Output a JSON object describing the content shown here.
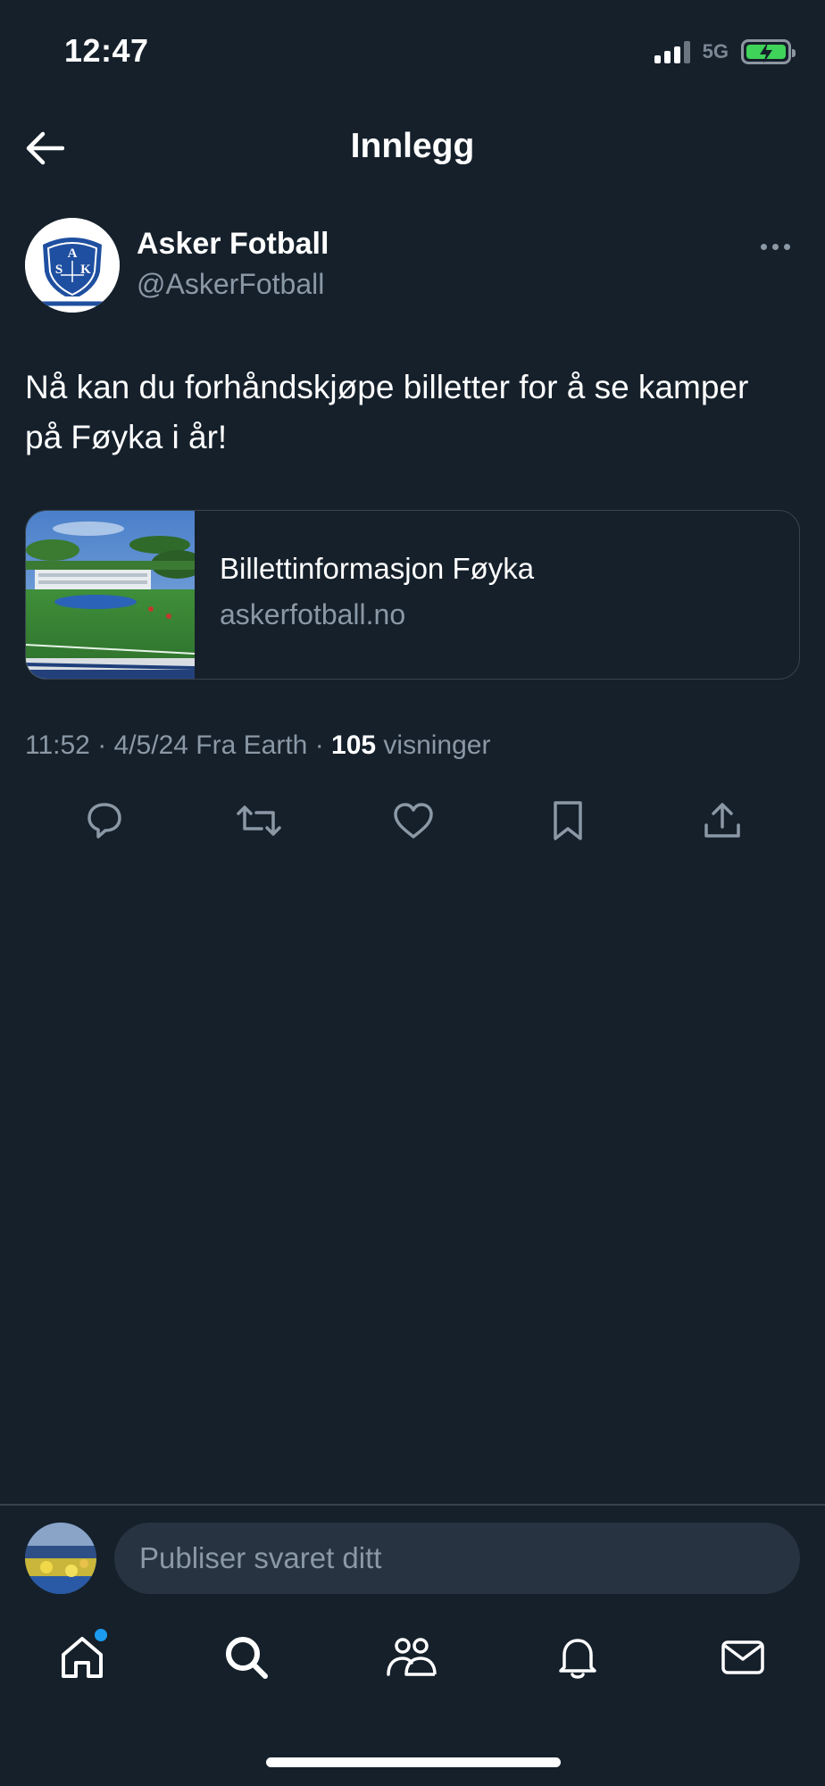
{
  "status_bar": {
    "time": "12:47",
    "network": "5G",
    "signal_bars": 3,
    "battery_charging": true
  },
  "nav": {
    "title": "Innlegg",
    "back_icon": "arrow-left-icon"
  },
  "post": {
    "author_name": "Asker Fotball",
    "author_handle": "@AskerFotball",
    "more_icon": "more-horizontal-icon",
    "text": "Nå kan du forhåndskjøpe billetter for å se kamper på Føyka i år!",
    "link_card": {
      "title": "Billettinformasjon Føyka",
      "domain": "askerfotball.no"
    },
    "meta": {
      "time": "11:52",
      "date": "4/5/24",
      "source": "Fra Earth",
      "views_count": "105",
      "views_label": "visninger"
    },
    "actions": [
      "reply-icon",
      "retweet-icon",
      "like-icon",
      "bookmark-icon",
      "share-icon"
    ]
  },
  "reply": {
    "placeholder": "Publiser svaret ditt"
  },
  "tabbar": {
    "items": [
      "home-icon",
      "search-icon",
      "communities-icon",
      "notifications-icon",
      "messages-icon"
    ],
    "home_has_badge": true,
    "badge_color": "#1d9bf0"
  },
  "colors": {
    "background": "#15202b",
    "secondary_text": "#8b98a5",
    "border": "#38444d",
    "accent": "#1d9bf0"
  }
}
